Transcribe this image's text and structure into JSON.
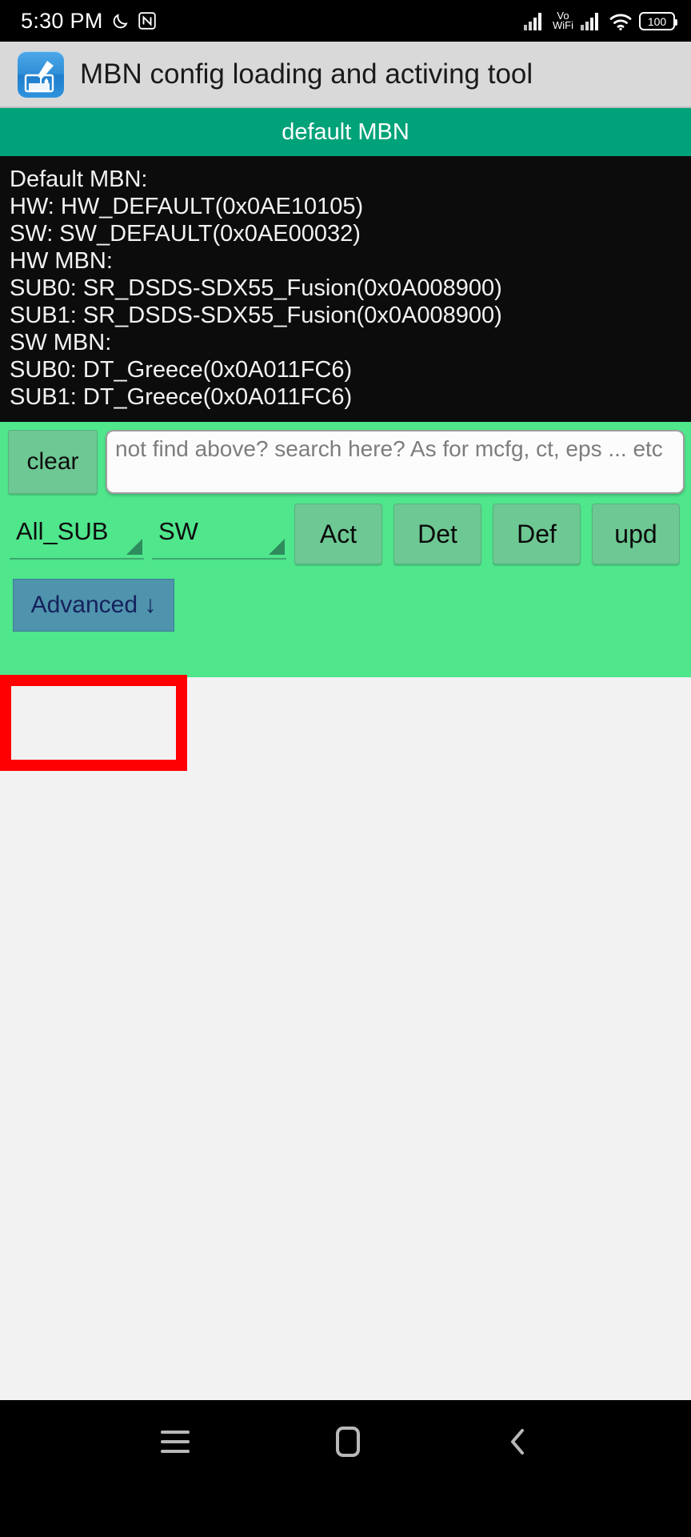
{
  "statusbar": {
    "time": "5:30 PM",
    "dnd_icon": "moon-icon",
    "nfc_icon": "nfc-icon",
    "signal1_icon": "signal-bars-icon",
    "vowifi_top": "Vo",
    "vowifi_bottom": "WiFi",
    "signal2_icon": "signal-bars-icon",
    "wifi_icon": "wifi-icon",
    "battery_level": "100"
  },
  "titlebar": {
    "app_icon": "app-icon",
    "title": "MBN config loading and activing tool"
  },
  "section": {
    "header": "default MBN"
  },
  "console": {
    "lines": [
      "Default MBN:",
      "HW: HW_DEFAULT(0x0AE10105)",
      "SW: SW_DEFAULT(0x0AE00032)",
      "HW MBN:",
      "SUB0: SR_DSDS-SDX55_Fusion(0x0A008900)",
      "SUB1: SR_DSDS-SDX55_Fusion(0x0A008900)",
      "SW MBN:",
      "SUB0: DT_Greece(0x0A011FC6)",
      "SUB1: DT_Greece(0x0A011FC6)"
    ]
  },
  "panel": {
    "clear_label": "clear",
    "search_placeholder": "not find above? search here? As for mcfg, ct, eps ... etc",
    "search_value": "",
    "spinner_sub": "All_SUB",
    "spinner_type": "SW",
    "buttons": [
      {
        "label": "Act"
      },
      {
        "label": "Det"
      },
      {
        "label": "Def"
      },
      {
        "label": "upd"
      }
    ],
    "advanced_label": "Advanced ↓",
    "highlight_color": "#fe0000",
    "panel_color": "#4fe68c",
    "button_color": "#6ec894",
    "advanced_color": "#4f93ad",
    "header_color": "#00a279"
  },
  "navbar": {
    "recents_icon": "recents-icon",
    "home_icon": "home-icon",
    "back_icon": "back-icon"
  }
}
